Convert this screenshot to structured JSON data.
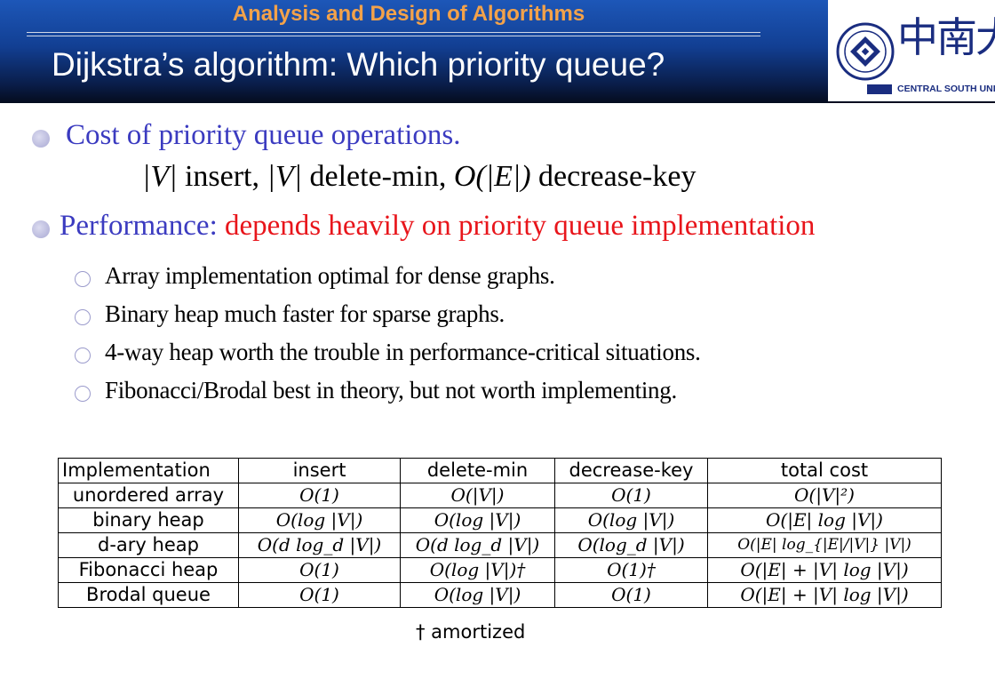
{
  "header": {
    "course": "Analysis and Design of Algorithms",
    "title": "Dijkstra’s algorithm: Which priority queue?",
    "logo_chinese": "中南大学",
    "logo_english": "CENTRAL SOUTH UNIVERSITY"
  },
  "bullets": {
    "cost": "Cost of priority queue operations.",
    "formula": {
      "v1": "|V|",
      "t1": " insert, ",
      "v2": "|V|",
      "t2": " delete-min,  ",
      "o": "O",
      "e": "(|E|)",
      "t3": " decrease-key"
    },
    "performance_label": "Performance: ",
    "performance_highlight": "depends heavily on priority queue implementation",
    "sub": [
      "Array implementation optimal for dense graphs.",
      "Binary heap much faster for sparse graphs.",
      "4-way heap worth the trouble in performance-critical  situations.",
      "Fibonacci/Brodal best in theory, but not worth implementing."
    ]
  },
  "table": {
    "headers": [
      "Implementation",
      "insert",
      "delete-min",
      "decrease-key",
      "total cost"
    ],
    "rows": [
      [
        "unordered array",
        "O(1)",
        "O(|V|)",
        "O(1)",
        "O(|V|²)"
      ],
      [
        "binary heap",
        "O(log |V|)",
        "O(log |V|)",
        "O(log |V|)",
        "O(|E| log |V|)"
      ],
      [
        "d-ary heap",
        "O(d log_d |V|)",
        "O(d log_d |V|)",
        "O(log_d |V|)",
        "O(|E| log_{|E|/|V|} |V|)"
      ],
      [
        "Fibonacci heap",
        "O(1)",
        "O(log |V|)†",
        "O(1)†",
        "O(|E| + |V| log |V|)"
      ],
      [
        "Brodal queue",
        "O(1)",
        "O(log |V|)",
        "O(1)",
        "O(|E| + |V| log |V|)"
      ]
    ],
    "footnote": "† amortized"
  },
  "colors": {
    "header_blue": "#123f93",
    "course_orange": "#f3a24a",
    "bullet_blue": "#3b3bc0",
    "highlight_red": "#e8151b",
    "logo_blue": "#1a2d80"
  }
}
